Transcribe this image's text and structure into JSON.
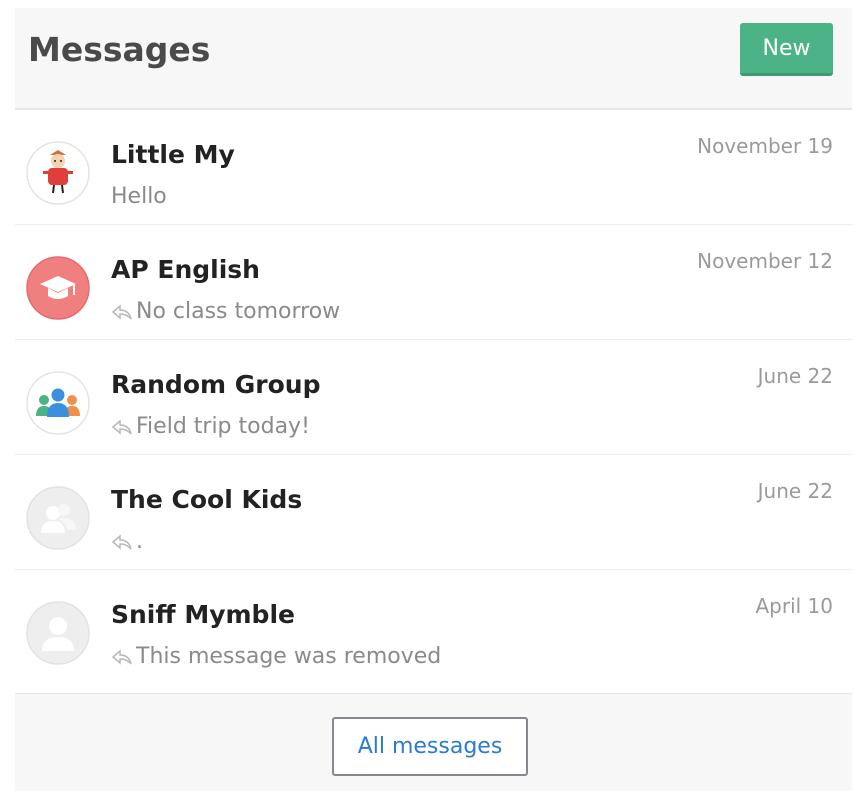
{
  "header": {
    "title": "Messages",
    "new_label": "New"
  },
  "conversations": [
    {
      "name": "Little My",
      "preview": "Hello",
      "date": "November 19",
      "avatar": "little-my-avatar",
      "reply": false
    },
    {
      "name": "AP English",
      "preview": "No class tomorrow",
      "date": "November 12",
      "avatar": "graduation-cap-icon",
      "reply": true
    },
    {
      "name": "Random Group",
      "preview": "Field trip today!",
      "date": "June 22",
      "avatar": "group-people-icon",
      "reply": true
    },
    {
      "name": "The Cool Kids",
      "preview": ".",
      "date": "June 22",
      "avatar": "group-placeholder-icon",
      "reply": true
    },
    {
      "name": "Sniff Mymble",
      "preview": "This message was removed",
      "date": "April 10",
      "avatar": "user-placeholder-icon",
      "reply": true
    }
  ],
  "footer": {
    "all_messages_label": "All messages"
  },
  "colors": {
    "accent_green": "#4cb387",
    "link_blue": "#2a7bd4",
    "ap_english_red": "#f08080"
  }
}
